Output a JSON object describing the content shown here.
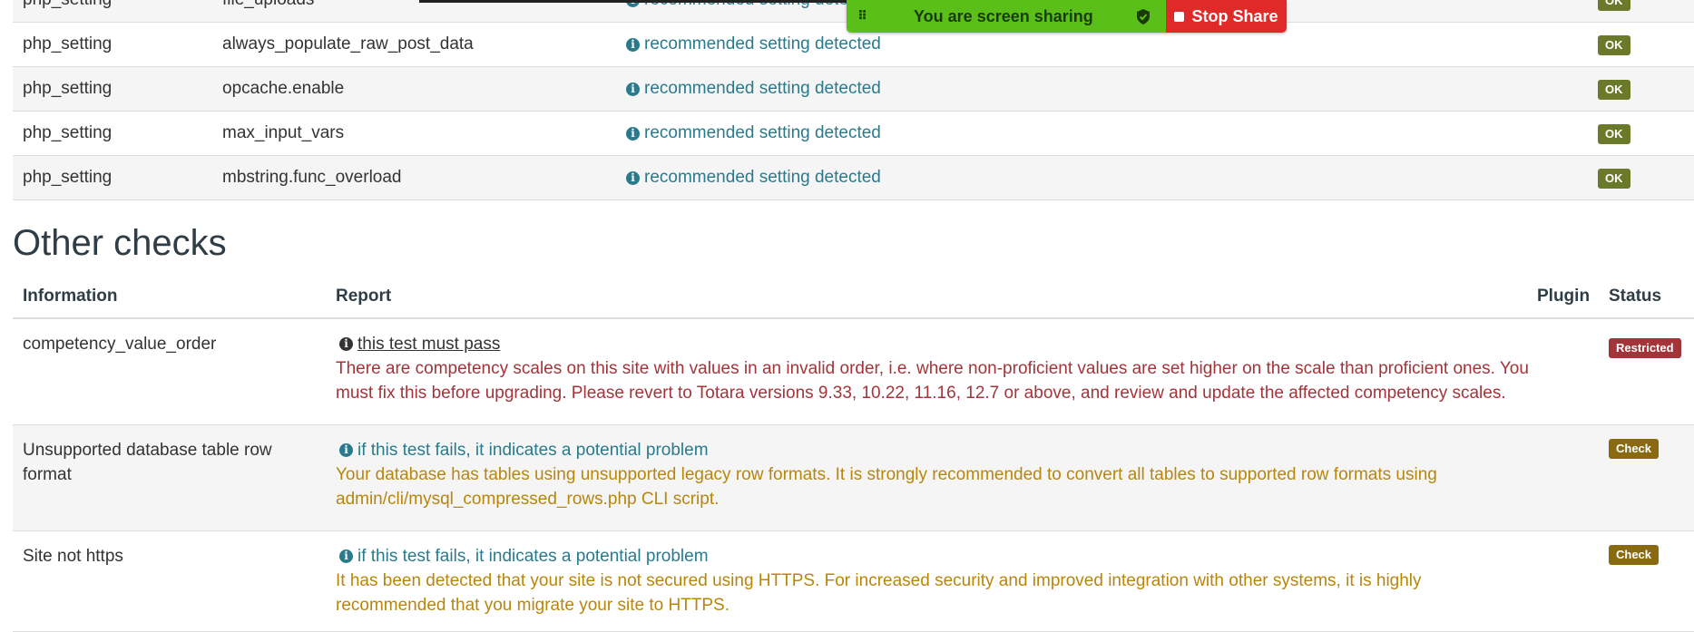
{
  "php_settings": [
    {
      "name": "php_setting",
      "setting": "file_uploads",
      "report": "recommended setting detected",
      "status": "OK"
    },
    {
      "name": "php_setting",
      "setting": "always_populate_raw_post_data",
      "report": "recommended setting detected",
      "status": "OK"
    },
    {
      "name": "php_setting",
      "setting": "opcache.enable",
      "report": "recommended setting detected",
      "status": "OK"
    },
    {
      "name": "php_setting",
      "setting": "max_input_vars",
      "report": "recommended setting detected",
      "status": "OK"
    },
    {
      "name": "php_setting",
      "setting": "mbstring.func_overload",
      "report": "recommended setting detected",
      "status": "OK"
    }
  ],
  "share_banner": {
    "text": "You are screen sharing",
    "stop_label": "Stop Share"
  },
  "other_checks": {
    "title": "Other checks",
    "headers": {
      "information": "Information",
      "report": "Report",
      "plugin": "Plugin",
      "status": "Status"
    },
    "rows": [
      {
        "info": "competency_value_order",
        "report_head": "this test must pass",
        "report_body": "There are competency scales on this site with values in an invalid order, i.e. where non-proficient values are set higher on the scale than proficient ones. You must fix this before upgrading. Please revert to Totara versions 9.33, 10.22, 11.16, 12.7 or above, and review and update the affected competency scales.",
        "status": "Restricted"
      },
      {
        "info": "Unsupported database table row format",
        "report_head": "if this test fails, it indicates a potential problem",
        "report_body": "Your database has tables using unsupported legacy row formats. It is strongly recommended to convert all tables to supported row formats using admin/cli/mysql_compressed_rows.php CLI script.",
        "status": "Check"
      },
      {
        "info": "Site not https",
        "report_head": "if this test fails, it indicates a potential problem",
        "report_body": "It has been detected that your site is not secured using HTTPS. For increased security and improved integration with other systems, it is highly recommended that you migrate your site to HTTPS.",
        "status": "Check"
      }
    ]
  },
  "colors": {
    "ok_badge": "#6b7a2a",
    "restricted_badge": "#a3343a",
    "check_badge": "#8a6a10",
    "share_green": "#5bbf1a",
    "share_red": "#e02a2a",
    "info_teal": "#2a7a8c"
  }
}
